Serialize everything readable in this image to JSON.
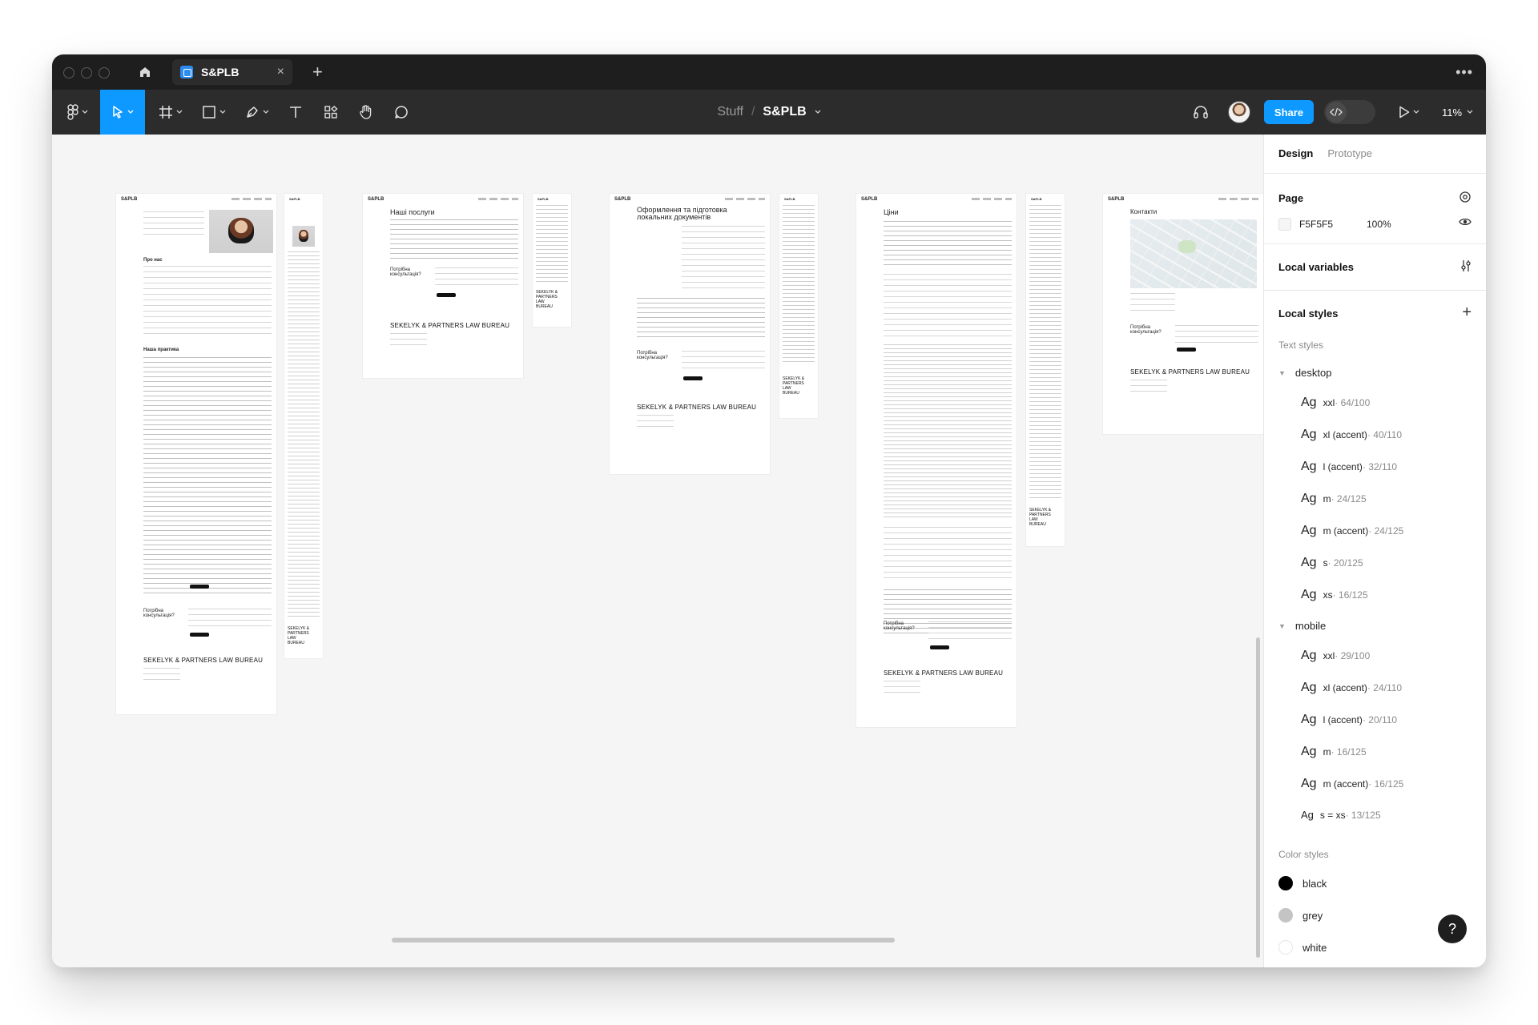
{
  "tab": {
    "title": "S&PLB",
    "close": "×",
    "add": "+"
  },
  "topbar": {
    "more": "•••"
  },
  "breadcrumb": {
    "project": "Stuff",
    "separator": "/",
    "file": "S&PLB"
  },
  "toolbar": {
    "share_label": "Share",
    "zoom": "11%"
  },
  "frames": {
    "logo": "S&PLB",
    "about_title": "Про нас",
    "practice_title": "Наша практика",
    "services_title": "Наші послуги",
    "docs_title": "Оформлення та підготовка локальних документів",
    "prices_title": "Ціни",
    "contacts_title": "Контакти",
    "consult_title": "Потрібна консультація?",
    "brand": "SEKELYK & PARTNERS LAW BUREAU",
    "brand_mobile": "SEKELYK & PARTNERS LAW BUREAU"
  },
  "panel": {
    "tab_design": "Design",
    "tab_prototype": "Prototype",
    "page_title": "Page",
    "page_color": "F5F5F5",
    "page_opacity": "100%",
    "local_variables": "Local variables",
    "local_styles": "Local styles",
    "text_styles_title": "Text styles",
    "groups": {
      "desktop": {
        "label": "desktop",
        "styles": [
          {
            "ag": "Ag",
            "name": "xxl",
            "spec": " · 64/100"
          },
          {
            "ag": "Ag",
            "name": "xl (accent)",
            "spec": " · 40/110"
          },
          {
            "ag": "Ag",
            "name": "l (accent)",
            "spec": " · 32/110"
          },
          {
            "ag": "Ag",
            "name": "m",
            "spec": " · 24/125"
          },
          {
            "ag": "Ag",
            "name": "m (accent)",
            "spec": " · 24/125"
          },
          {
            "ag": "Ag",
            "name": "s",
            "spec": " · 20/125"
          },
          {
            "ag": "Ag",
            "name": "xs",
            "spec": " · 16/125"
          }
        ]
      },
      "mobile": {
        "label": "mobile",
        "styles": [
          {
            "ag": "Ag",
            "name": "xxl",
            "spec": " · 29/100"
          },
          {
            "ag": "Ag",
            "name": "xl (accent)",
            "spec": " · 24/110"
          },
          {
            "ag": "Ag",
            "name": "l (accent)",
            "spec": " · 20/110"
          },
          {
            "ag": "Ag",
            "name": "m",
            "spec": " · 16/125"
          },
          {
            "ag": "Ag",
            "name": "m (accent)",
            "spec": " · 16/125"
          },
          {
            "ag": "Ag",
            "name": "s = xs",
            "spec": " · 13/125"
          }
        ]
      }
    },
    "color_styles_title": "Color styles",
    "colors": [
      {
        "name": "black",
        "hex": "#000000"
      },
      {
        "name": "grey",
        "hex": "#c4c4c4"
      },
      {
        "name": "white",
        "hex": "#ffffff"
      }
    ],
    "help": "?"
  },
  "colors": {
    "accent": "#0d99ff",
    "toolbar_bg": "#2c2c2c",
    "titlebar_bg": "#1e1e1e",
    "canvas_bg": "#f5f5f5"
  },
  "icons": [
    "home-icon",
    "figma-menu-icon",
    "move-tool-icon",
    "frame-tool-icon",
    "rectangle-tool-icon",
    "pen-tool-icon",
    "text-tool-icon",
    "resources-icon",
    "hand-tool-icon",
    "comment-icon",
    "headphones-icon",
    "code-icon",
    "play-icon",
    "eye-icon",
    "styles-icon",
    "variables-icon",
    "plus-icon"
  ]
}
